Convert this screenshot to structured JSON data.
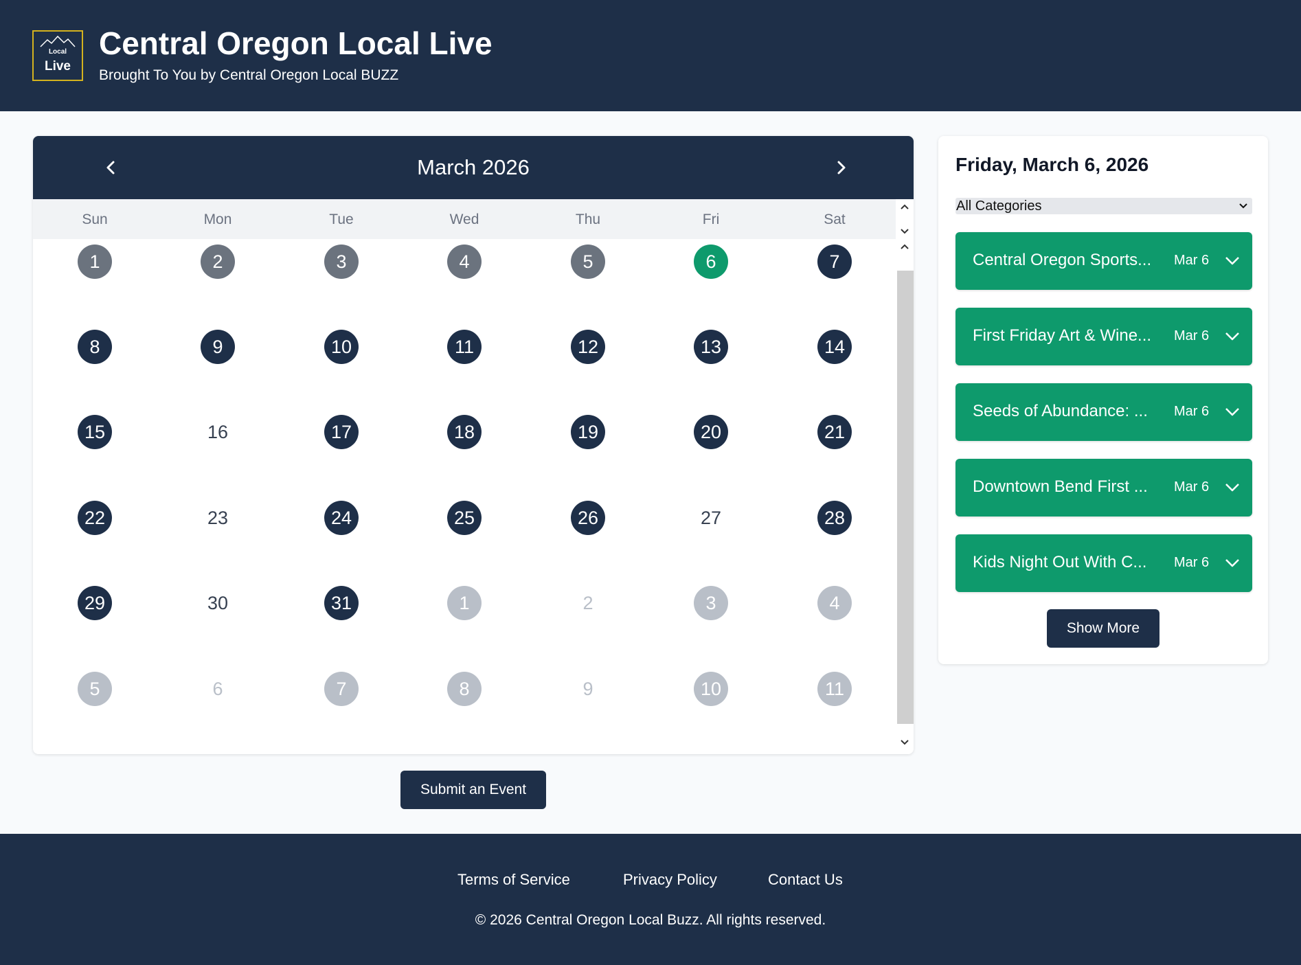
{
  "header": {
    "logo_top": "Local",
    "logo_bottom": "Live",
    "title": "Central Oregon Local Live",
    "subtitle": "Brought To You by Central Oregon Local BUZZ"
  },
  "calendar": {
    "month_label": "March 2026",
    "weekdays": [
      "Sun",
      "Mon",
      "Tue",
      "Wed",
      "Thu",
      "Fri",
      "Sat"
    ],
    "weeks": [
      [
        {
          "d": "1",
          "s": "past"
        },
        {
          "d": "2",
          "s": "past"
        },
        {
          "d": "3",
          "s": "past"
        },
        {
          "d": "4",
          "s": "past"
        },
        {
          "d": "5",
          "s": "past"
        },
        {
          "d": "6",
          "s": "today"
        },
        {
          "d": "7",
          "s": "ev"
        }
      ],
      [
        {
          "d": "8",
          "s": "ev"
        },
        {
          "d": "9",
          "s": "ev"
        },
        {
          "d": "10",
          "s": "ev"
        },
        {
          "d": "11",
          "s": "ev"
        },
        {
          "d": "12",
          "s": "ev"
        },
        {
          "d": "13",
          "s": "ev"
        },
        {
          "d": "14",
          "s": "ev"
        }
      ],
      [
        {
          "d": "15",
          "s": "ev"
        },
        {
          "d": "16",
          "s": "plain"
        },
        {
          "d": "17",
          "s": "ev"
        },
        {
          "d": "18",
          "s": "ev"
        },
        {
          "d": "19",
          "s": "ev"
        },
        {
          "d": "20",
          "s": "ev"
        },
        {
          "d": "21",
          "s": "ev"
        }
      ],
      [
        {
          "d": "22",
          "s": "ev"
        },
        {
          "d": "23",
          "s": "plain"
        },
        {
          "d": "24",
          "s": "ev"
        },
        {
          "d": "25",
          "s": "ev"
        },
        {
          "d": "26",
          "s": "ev"
        },
        {
          "d": "27",
          "s": "plain"
        },
        {
          "d": "28",
          "s": "ev"
        }
      ],
      [
        {
          "d": "29",
          "s": "ev"
        },
        {
          "d": "30",
          "s": "plain"
        },
        {
          "d": "31",
          "s": "ev"
        },
        {
          "d": "1",
          "s": "o-ev"
        },
        {
          "d": "2",
          "s": "o-plain"
        },
        {
          "d": "3",
          "s": "o-ev"
        },
        {
          "d": "4",
          "s": "o-ev"
        }
      ],
      [
        {
          "d": "5",
          "s": "o-ev"
        },
        {
          "d": "6",
          "s": "o-plain"
        },
        {
          "d": "7",
          "s": "o-ev"
        },
        {
          "d": "8",
          "s": "o-ev"
        },
        {
          "d": "9",
          "s": "o-plain"
        },
        {
          "d": "10",
          "s": "o-ev"
        },
        {
          "d": "11",
          "s": "o-ev"
        }
      ]
    ],
    "submit_label": "Submit an Event"
  },
  "sidebar": {
    "selected_date": "Friday, March 6, 2026",
    "category_filter": "All Categories",
    "events": [
      {
        "name": "Central Oregon Sports...",
        "date": "Mar 6"
      },
      {
        "name": "First Friday Art & Wine...",
        "date": "Mar 6"
      },
      {
        "name": "Seeds of Abundance: ...",
        "date": "Mar 6"
      },
      {
        "name": "Downtown Bend First ...",
        "date": "Mar 6"
      },
      {
        "name": "Kids Night Out With C...",
        "date": "Mar 6"
      }
    ],
    "show_more_label": "Show More"
  },
  "footer": {
    "links": [
      "Terms of Service",
      "Privacy Policy",
      "Contact Us"
    ],
    "copyright": "© 2026 Central Oregon Local Buzz. All rights reserved."
  },
  "colors": {
    "navy": "#1e2f48",
    "green": "#0e9a6c",
    "past_gray": "#6b737e",
    "faded_gray": "#b9bfc8"
  },
  "icons": [
    "mountain-logo-icon",
    "chevron-left-icon",
    "chevron-right-icon",
    "chevron-down-icon",
    "scroll-up-icon",
    "scroll-down-icon"
  ]
}
